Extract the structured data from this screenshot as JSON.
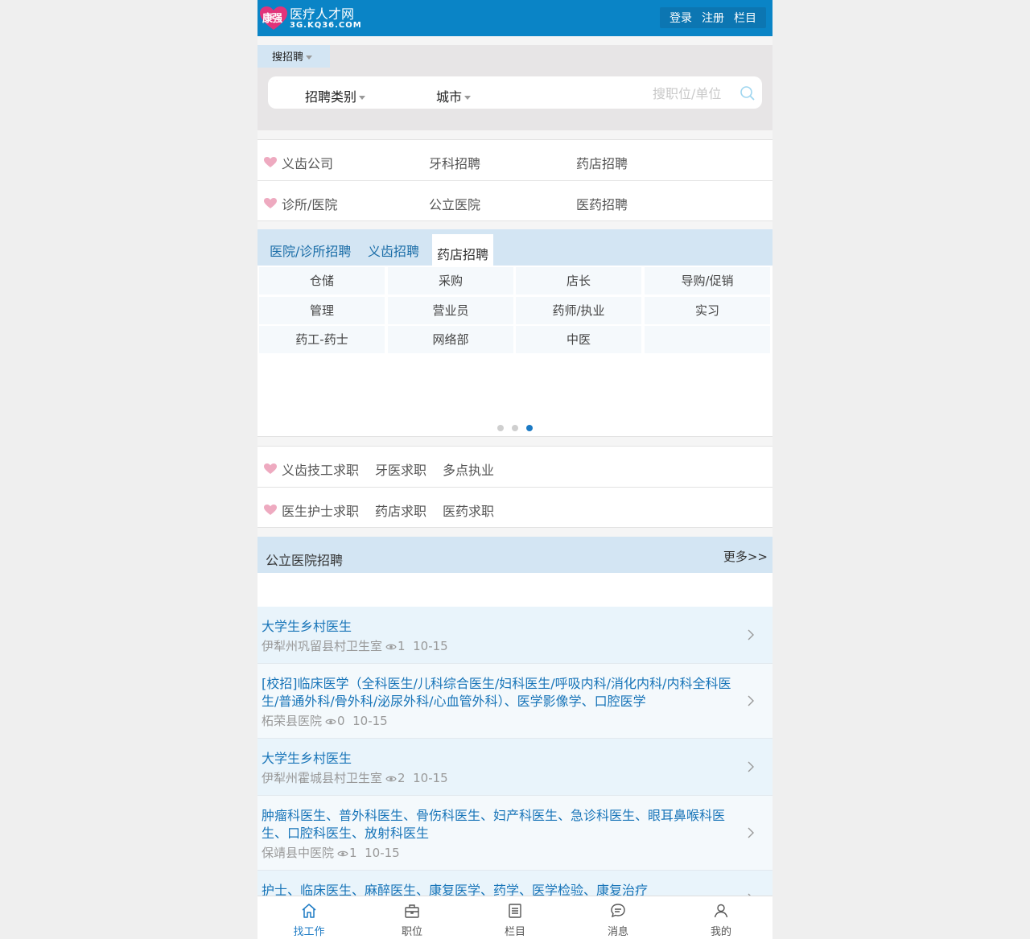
{
  "header": {
    "logo_badge": "康强",
    "logo_title": "医疗人才网",
    "logo_domain": "3G.KQ36.COM",
    "links": [
      "登录",
      "注册",
      "栏目"
    ]
  },
  "search": {
    "tab_label": "搜招聘",
    "category_label": "招聘类别",
    "city_label": "城市",
    "placeholder": "搜职位/单位"
  },
  "quick_links": {
    "row1": [
      "义齿公司",
      "牙科招聘",
      "药店招聘"
    ],
    "row2": [
      "诊所/医院",
      "公立医院",
      "医药招聘"
    ]
  },
  "panel": {
    "tabs": [
      "医院/诊所招聘",
      "义齿招聘",
      "药店招聘"
    ],
    "active_tab": "药店招聘",
    "grid": [
      [
        "仓储",
        "采购",
        "店长",
        "导购/促销"
      ],
      [
        "管理",
        "营业员",
        "药师/执业",
        "实习"
      ],
      [
        "药工-药士",
        "网络部",
        "中医",
        ""
      ]
    ],
    "pager_active": 3,
    "pager_count": 3
  },
  "seek_links": {
    "row1": [
      "义齿技工求职",
      "牙医求职",
      "多点执业"
    ],
    "row2": [
      "医生护士求职",
      "药店求职",
      "医药求职"
    ]
  },
  "section": {
    "title": "公立医院招聘",
    "more": "更多>>"
  },
  "jobs": [
    {
      "title": "大学生乡村医生",
      "org": "伊犁州巩留县村卫生室",
      "views": "1",
      "date": "10-15"
    },
    {
      "title": "[校招]临床医学（全科医生/儿科综合医生/妇科医生/呼吸内科/消化内科/内科全科医生/普通外科/骨外科/泌尿外科/心血管外科）、医学影像学、口腔医学",
      "org": "柘荣县医院",
      "views": "0",
      "date": "10-15"
    },
    {
      "title": "大学生乡村医生",
      "org": "伊犁州霍城县村卫生室",
      "views": "2",
      "date": "10-15"
    },
    {
      "title": "肿瘤科医生、普外科医生、骨伤科医生、妇产科医生、急诊科医生、眼耳鼻喉科医生、口腔科医生、放射科医生",
      "org": "保靖县中医院",
      "views": "1",
      "date": "10-15"
    },
    {
      "title": "护士、临床医生、麻醉医生、康复医学、药学、医学检验、康复治疗",
      "org": "",
      "views": "",
      "date": ""
    }
  ],
  "bottom_nav": [
    "找工作",
    "职位",
    "栏目",
    "消息",
    "我的"
  ],
  "colors": {
    "header": "#0a84c6",
    "accent": "#1c7ac4",
    "tab_bg": "#d3e5f3",
    "heart": "#eeaac0"
  }
}
